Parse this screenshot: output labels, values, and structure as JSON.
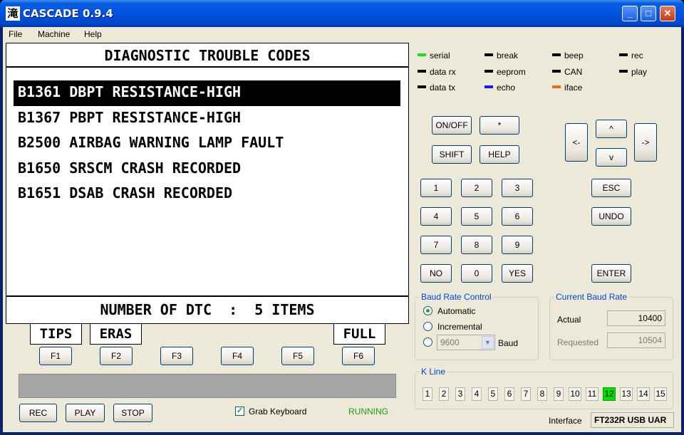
{
  "window": {
    "title": "CASCADE 0.9.4",
    "icon_glyph": "滝"
  },
  "menu": [
    "File",
    "Machine",
    "Help"
  ],
  "display": {
    "header": "DIAGNOSTIC TROUBLE CODES",
    "dtcs": [
      "B1361 DBPT RESISTANCE-HIGH",
      "B1367 PBPT RESISTANCE-HIGH",
      "B2500 AIRBAG WARNING LAMP FAULT",
      "B1650 SRSCM CRASH RECORDED",
      "B1651 DSAB CRASH RECORDED"
    ],
    "selected_index": 0,
    "footer": "NUMBER OF DTC  :  5 ITEMS",
    "softkeys": {
      "f1": "TIPS",
      "f2": "ERAS",
      "f6": "FULL"
    }
  },
  "function_keys": [
    "F1",
    "F2",
    "F3",
    "F4",
    "F5",
    "F6"
  ],
  "controls": {
    "rec": "REC",
    "play": "PLAY",
    "stop": "STOP",
    "grab_keyboard": "Grab Keyboard",
    "grab_checked": true,
    "status": "RUNNING",
    "status_color": "#1e9a1e"
  },
  "indicators": [
    {
      "label": "serial",
      "color": "#22dd22"
    },
    {
      "label": "break",
      "color": "#000000"
    },
    {
      "label": "beep",
      "color": "#000000"
    },
    {
      "label": "rec",
      "color": "#000000"
    },
    {
      "label": "data rx",
      "color": "#000000"
    },
    {
      "label": "eeprom",
      "color": "#000000"
    },
    {
      "label": "CAN",
      "color": "#000000"
    },
    {
      "label": "play",
      "color": "#000000"
    },
    {
      "label": "data tx",
      "color": "#000000"
    },
    {
      "label": "echo",
      "color": "#1a1aee"
    },
    {
      "label": "iface",
      "color": "#ee6a22"
    }
  ],
  "keypad": {
    "on_off": "ON/OFF",
    "star": "*",
    "shift": "SHIFT",
    "help": "HELP",
    "up": "^",
    "down": "v",
    "left": "<-",
    "right": "->",
    "n1": "1",
    "n2": "2",
    "n3": "3",
    "n4": "4",
    "n5": "5",
    "n6": "6",
    "n7": "7",
    "n8": "8",
    "n9": "9",
    "no": "NO",
    "n0": "0",
    "yes": "YES",
    "esc": "ESC",
    "undo": "UNDO",
    "enter": "ENTER"
  },
  "baud_control": {
    "title": "Baud Rate Control",
    "automatic": "Automatic",
    "incremental": "Incremental",
    "selected": "Automatic",
    "baud_value": "9600",
    "baud_label": "Baud"
  },
  "current_baud": {
    "title": "Current Baud Rate",
    "actual_label": "Actual",
    "actual": "10400",
    "requested_label": "Requested",
    "requested": "10504"
  },
  "kline": {
    "title": "K Line",
    "lines": [
      "1",
      "2",
      "3",
      "4",
      "5",
      "6",
      "7",
      "8",
      "9",
      "10",
      "11",
      "12",
      "13",
      "14",
      "15"
    ],
    "active": "12"
  },
  "interface": {
    "label": "Interface",
    "value": "FT232R USB UAR"
  }
}
